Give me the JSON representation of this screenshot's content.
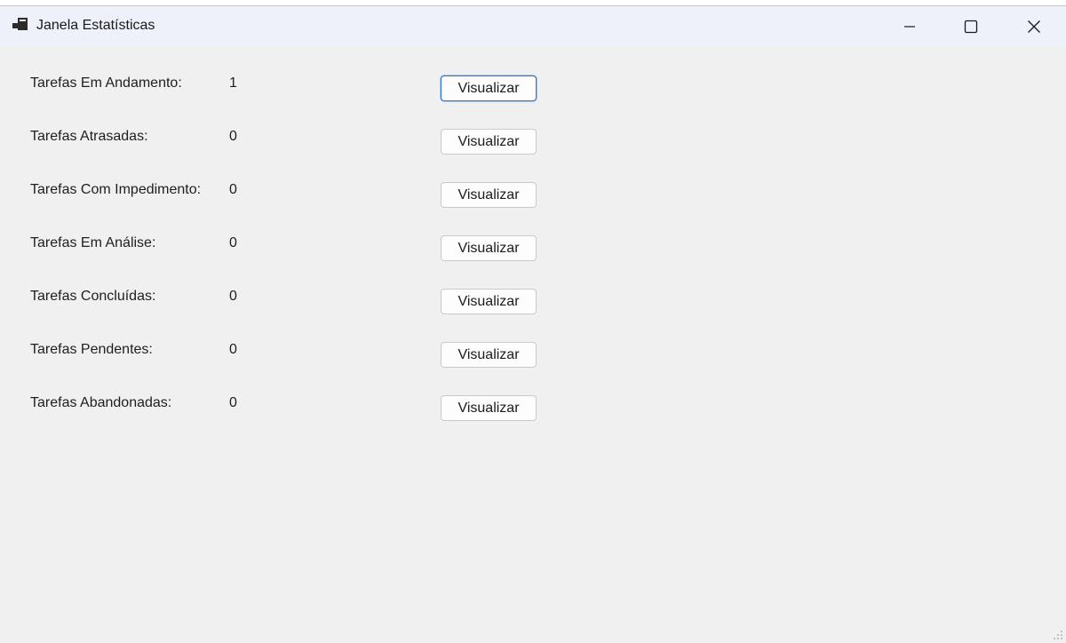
{
  "window": {
    "title": "Janela Estatísticas",
    "icon": "app-window-icon",
    "controls": [
      "minimize-icon",
      "maximize-icon",
      "close-icon"
    ]
  },
  "stats": [
    {
      "label": "Tarefas Em Andamento:",
      "value": "1",
      "button": "Visualizar"
    },
    {
      "label": "Tarefas Atrasadas:",
      "value": "0",
      "button": "Visualizar"
    },
    {
      "label": "Tarefas Com Impedimento:",
      "value": "0",
      "button": "Visualizar"
    },
    {
      "label": "Tarefas Em Análise:",
      "value": "0",
      "button": "Visualizar"
    },
    {
      "label": "Tarefas Concluídas:",
      "value": "0",
      "button": "Visualizar"
    },
    {
      "label": "Tarefas Pendentes:",
      "value": "0",
      "button": "Visualizar"
    },
    {
      "label": "Tarefas Abandonadas:",
      "value": "0",
      "button": "Visualizar"
    }
  ],
  "colors": {
    "background": "#f0f0f0",
    "titlebar": "#eef1f9",
    "focus_accent": "#2d7bd2"
  }
}
